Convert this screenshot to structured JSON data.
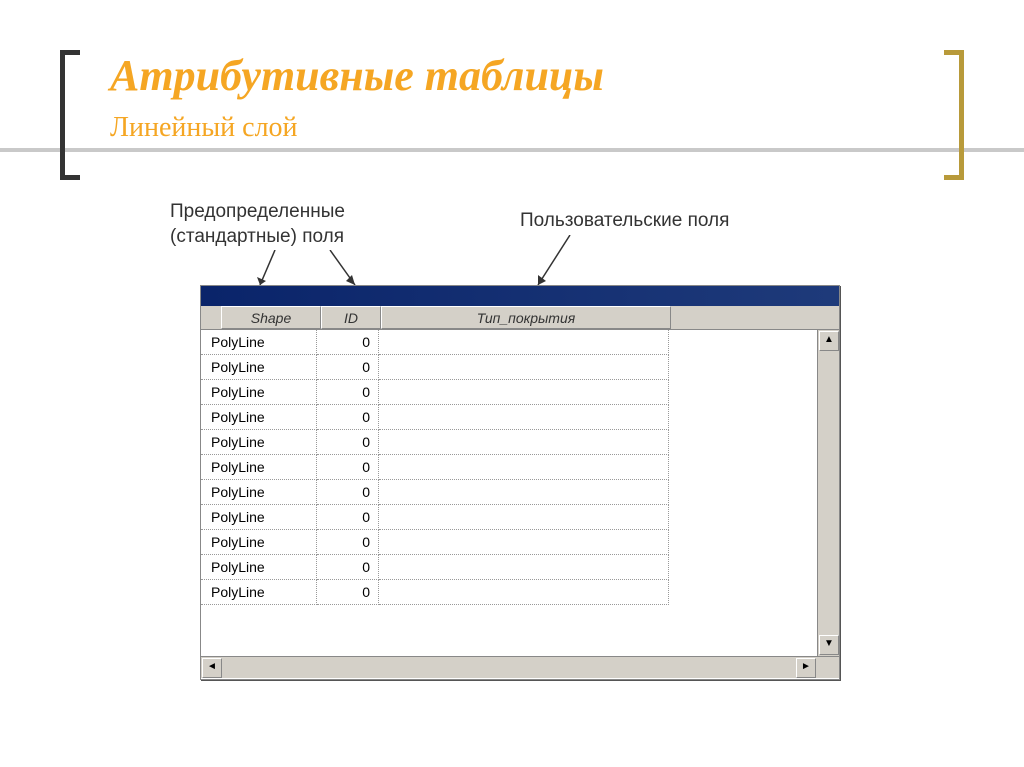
{
  "slide": {
    "title": "Атрибутивные таблицы",
    "subtitle": "Линейный слой"
  },
  "annotations": {
    "predefined_line1": "Предопределенные",
    "predefined_line2": "(стандартные) поля",
    "user": "Пользовательские поля"
  },
  "table": {
    "headers": {
      "shape": "Shape",
      "id": "ID",
      "type": "Тип_покрытия"
    },
    "rows": [
      {
        "shape": "PolyLine",
        "id": "0",
        "type": ""
      },
      {
        "shape": "PolyLine",
        "id": "0",
        "type": ""
      },
      {
        "shape": "PolyLine",
        "id": "0",
        "type": ""
      },
      {
        "shape": "PolyLine",
        "id": "0",
        "type": ""
      },
      {
        "shape": "PolyLine",
        "id": "0",
        "type": ""
      },
      {
        "shape": "PolyLine",
        "id": "0",
        "type": ""
      },
      {
        "shape": "PolyLine",
        "id": "0",
        "type": ""
      },
      {
        "shape": "PolyLine",
        "id": "0",
        "type": ""
      },
      {
        "shape": "PolyLine",
        "id": "0",
        "type": ""
      },
      {
        "shape": "PolyLine",
        "id": "0",
        "type": ""
      },
      {
        "shape": "PolyLine",
        "id": "0",
        "type": ""
      }
    ]
  }
}
